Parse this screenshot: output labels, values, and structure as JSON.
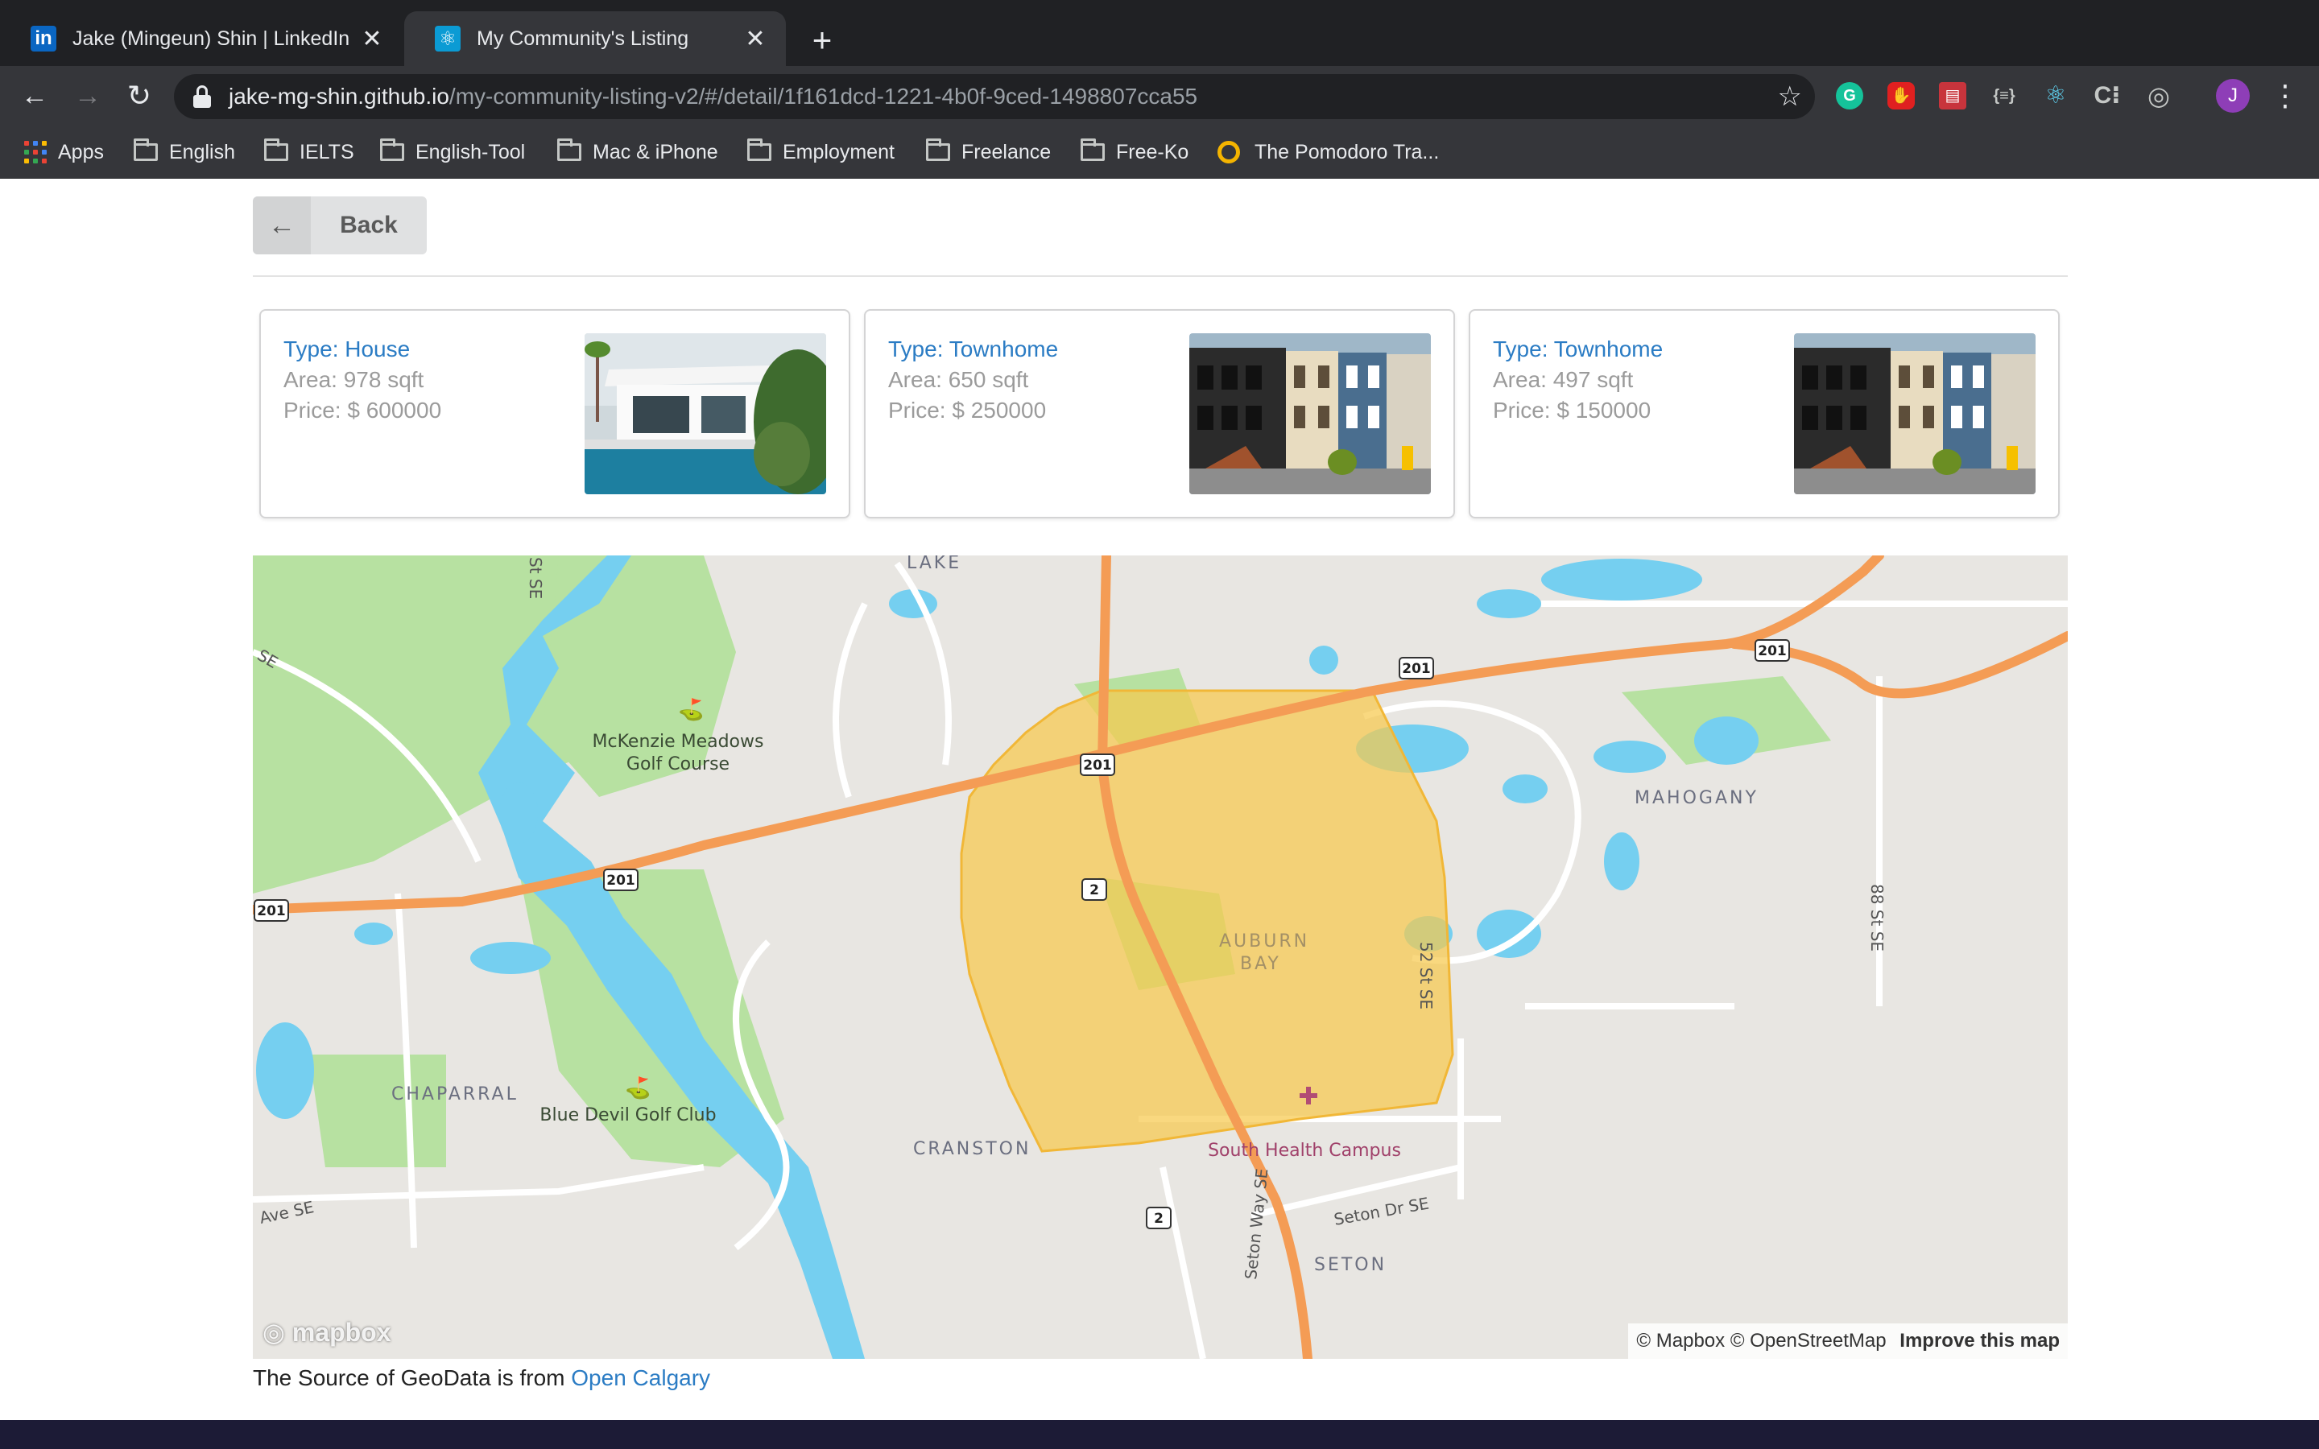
{
  "browser": {
    "tabs": [
      {
        "title": "Jake (Mingeun) Shin | LinkedIn",
        "icon": "linkedin-icon"
      },
      {
        "title": "My Community's Listing",
        "icon": "react-icon"
      }
    ],
    "url_host": "jake-mg-shin.github.io",
    "url_path": "/my-community-listing-v2/#/detail/1f161dcd-1221-4b0f-9ced-1498807cca55",
    "profile_initial": "J",
    "bookmarks": [
      "Apps",
      "English",
      "IELTS",
      "English-Tool",
      "Mac & iPhone",
      "Employment",
      "Freelance",
      "Free-Ko",
      "The Pomodoro Tra..."
    ]
  },
  "page": {
    "back_label": "Back",
    "listings": [
      {
        "type": "Type: House",
        "area": "Area: 978 sqft",
        "price": "Price: $ 600000"
      },
      {
        "type": "Type: Townhome",
        "area": "Area: 650 sqft",
        "price": "Price: $ 250000"
      },
      {
        "type": "Type: Townhome",
        "area": "Area: 497 sqft",
        "price": "Price: $ 150000"
      }
    ],
    "source_text": "The Source of GeoData is from ",
    "source_link": "Open Calgary"
  },
  "map": {
    "places": {
      "lake": "LAKE",
      "mckenzie": "McKenzie Meadows",
      "golf_course": "Golf Course",
      "mahogany": "MAHOGANY",
      "auburn": "AUBURN",
      "bay": "BAY",
      "chaparral": "CHAPARRAL",
      "blue_devil": "Blue Devil Golf Club",
      "cranston": "CRANSTON",
      "south_health": "South Health Campus",
      "seton": "SETON",
      "seton_way": "Seton Way SE",
      "seton_dr": "Seton Dr SE",
      "st52": "52 St SE",
      "st88": "88 St SE",
      "ave_se": "Ave SE",
      "se_topleft": "SE",
      "st_se_top": "St SE"
    },
    "shields": {
      "r201": "201",
      "r2": "2"
    },
    "attribution_mapbox": "© Mapbox",
    "attribution_osm": "© OpenStreetMap",
    "attribution_improve": "Improve this map",
    "logo": "mapbox"
  },
  "colors": {
    "link": "#2b7cc4",
    "highway": "#f49c55",
    "water": "#72c6e8",
    "park": "#a8dc95",
    "highlight": "#f6c94d"
  }
}
